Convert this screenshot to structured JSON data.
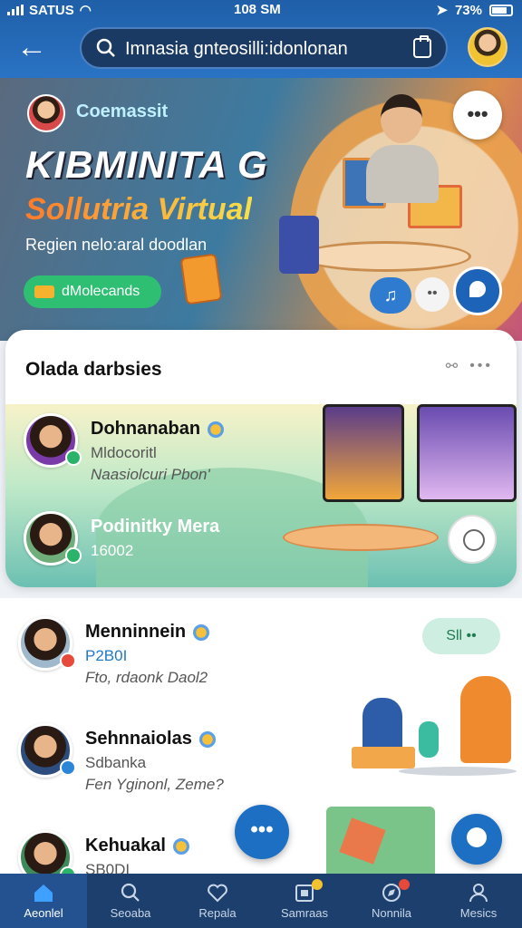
{
  "status_bar": {
    "carrier": "SATUS",
    "time": "108 SM",
    "battery": "73%"
  },
  "header": {
    "search_text": "Imnasia gnteosilli:idonlonan",
    "icons": [
      "back-arrow-icon",
      "search-icon",
      "clipboard-icon"
    ]
  },
  "hero": {
    "brand": "Coemassit",
    "title": "KIBMINITA G",
    "subtitle": "Sollutria Virtual",
    "description": "Regien nelo:aral doodlan",
    "pill_label": "dMolecands"
  },
  "card": {
    "title": "Olada darbsies",
    "rows": [
      {
        "name": "Dohnanaban",
        "line2": "Mldocoritl",
        "line3": "Naasiolcuri Pbon'"
      },
      {
        "name": "Podinitky Mera",
        "line2": "16002",
        "line3": ""
      }
    ]
  },
  "list": {
    "badge": "Sll ••",
    "rows": [
      {
        "name": "Menninnein",
        "line2": "P2B0I",
        "line3": "Fto, rdaonk Daol2",
        "status": "red"
      },
      {
        "name": "Sehnnaiolas",
        "line2": "Sdbanka",
        "line3": "Fen Yginonl, Zeme?",
        "status": "blue"
      },
      {
        "name": "Kehuakal",
        "line2": "SB0DI",
        "line3": "",
        "status": "green"
      }
    ]
  },
  "nav": [
    {
      "label": "Aeonlel",
      "icon": "home-icon",
      "active": true
    },
    {
      "label": "Seoaba",
      "icon": "search-icon",
      "active": false
    },
    {
      "label": "Repala",
      "icon": "heart-icon",
      "active": false
    },
    {
      "label": "Samraas",
      "icon": "media-icon",
      "active": false
    },
    {
      "label": "Nonnila",
      "icon": "compass-icon",
      "active": false
    },
    {
      "label": "Mesics",
      "icon": "profile-icon",
      "active": false
    }
  ],
  "colors": {
    "header": "#1f5fa8",
    "nav": "#1c3f6e",
    "accent": "#1d6fc4",
    "green": "#2fbf73"
  }
}
